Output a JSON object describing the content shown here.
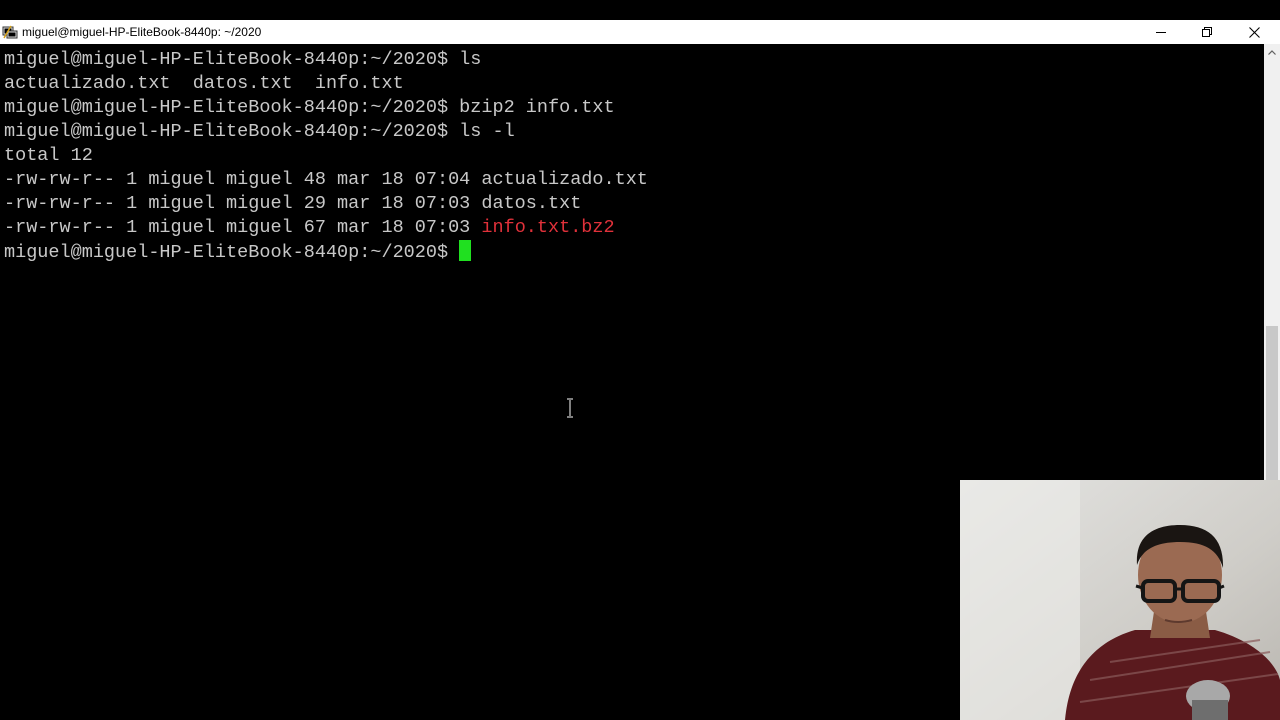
{
  "window": {
    "title": "miguel@miguel-HP-EliteBook-8440p: ~/2020",
    "icon": "putty-terminal-icon",
    "controls": [
      "minimize-icon",
      "restore-icon",
      "close-icon"
    ]
  },
  "terminal": {
    "lines": [
      {
        "text": "miguel@miguel-HP-EliteBook-8440p:~/2020$ ls"
      },
      {
        "text": "actualizado.txt  datos.txt  info.txt"
      },
      {
        "text": "miguel@miguel-HP-EliteBook-8440p:~/2020$ bzip2 info.txt"
      },
      {
        "text": "miguel@miguel-HP-EliteBook-8440p:~/2020$ ls -l"
      },
      {
        "text": "total 12"
      },
      {
        "text": "-rw-rw-r-- 1 miguel miguel 48 mar 18 07:04 actualizado.txt"
      },
      {
        "text": "-rw-rw-r-- 1 miguel miguel 29 mar 18 07:03 datos.txt"
      },
      {
        "prefix": "-rw-rw-r-- 1 miguel miguel 67 mar 18 07:03 ",
        "highlight": "info.txt.bz2"
      },
      {
        "text": "miguel@miguel-HP-EliteBook-8440p:~/2020$ "
      }
    ],
    "colors": {
      "background": "#000000",
      "foreground": "#c8c8c8",
      "compressed_file": "#e0313a",
      "cursor": "#20e020"
    }
  },
  "overlay": {
    "webcam": "webcam-video"
  }
}
